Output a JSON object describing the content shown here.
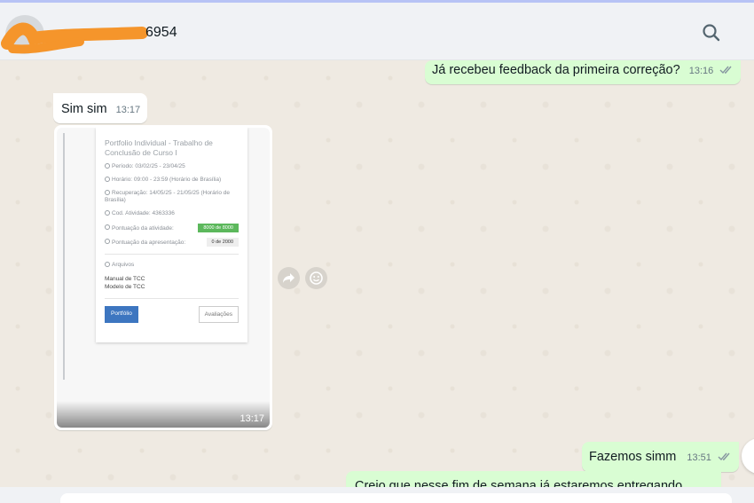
{
  "header": {
    "contact_name": "6954",
    "search_icon": "search-icon"
  },
  "messages": [
    {
      "direction": "out",
      "text": "Já recebeu feedback da primeira correção?",
      "time": "13:16",
      "status": "read"
    },
    {
      "direction": "in",
      "text": "Sim sim",
      "time": "13:17"
    },
    {
      "direction": "in",
      "type": "image",
      "time": "13:17",
      "image_content": {
        "title": "Portfolio Individual - Trabalho de Conclusão de Curso I",
        "periodo": "Período: 03/02/25 - 23/04/25",
        "horario": "Horário: 09:00 - 23:59 (Horário de Brasília)",
        "recuperacao": "Recuperação: 14/05/25 - 21/05/25 (Horário de Brasília)",
        "cod_atividade": "Cod. Atividade: 4363336",
        "pontuacao_atividade_label": "Pontuação da atividade:",
        "pontuacao_atividade_value": "8000 de 8000",
        "pontuacao_apresentacao_label": "Pontuação da apresentação:",
        "pontuacao_apresentacao_value": "0 de 2000",
        "arquivos_label": "Arquivos",
        "files": [
          "Manual de TCC",
          "Modelo de TCC"
        ],
        "button_primary": "Portfólio",
        "button_secondary": "Avaliações"
      }
    },
    {
      "direction": "out",
      "text": "Fazemos simm",
      "time": "13:51",
      "status": "read"
    },
    {
      "direction": "out",
      "text": "Creio que nesse fim de semana já estaremos entregando"
    }
  ],
  "icons": {
    "forward": "forward-icon",
    "emoji": "emoji-icon",
    "read_receipt": "double-check-icon"
  },
  "colors": {
    "outgoing_bubble": "#d9fdd3",
    "incoming_bubble": "#ffffff",
    "chat_background": "#efeae2",
    "header_background": "#f0f2f5",
    "read_ticks": "#8696a0"
  }
}
